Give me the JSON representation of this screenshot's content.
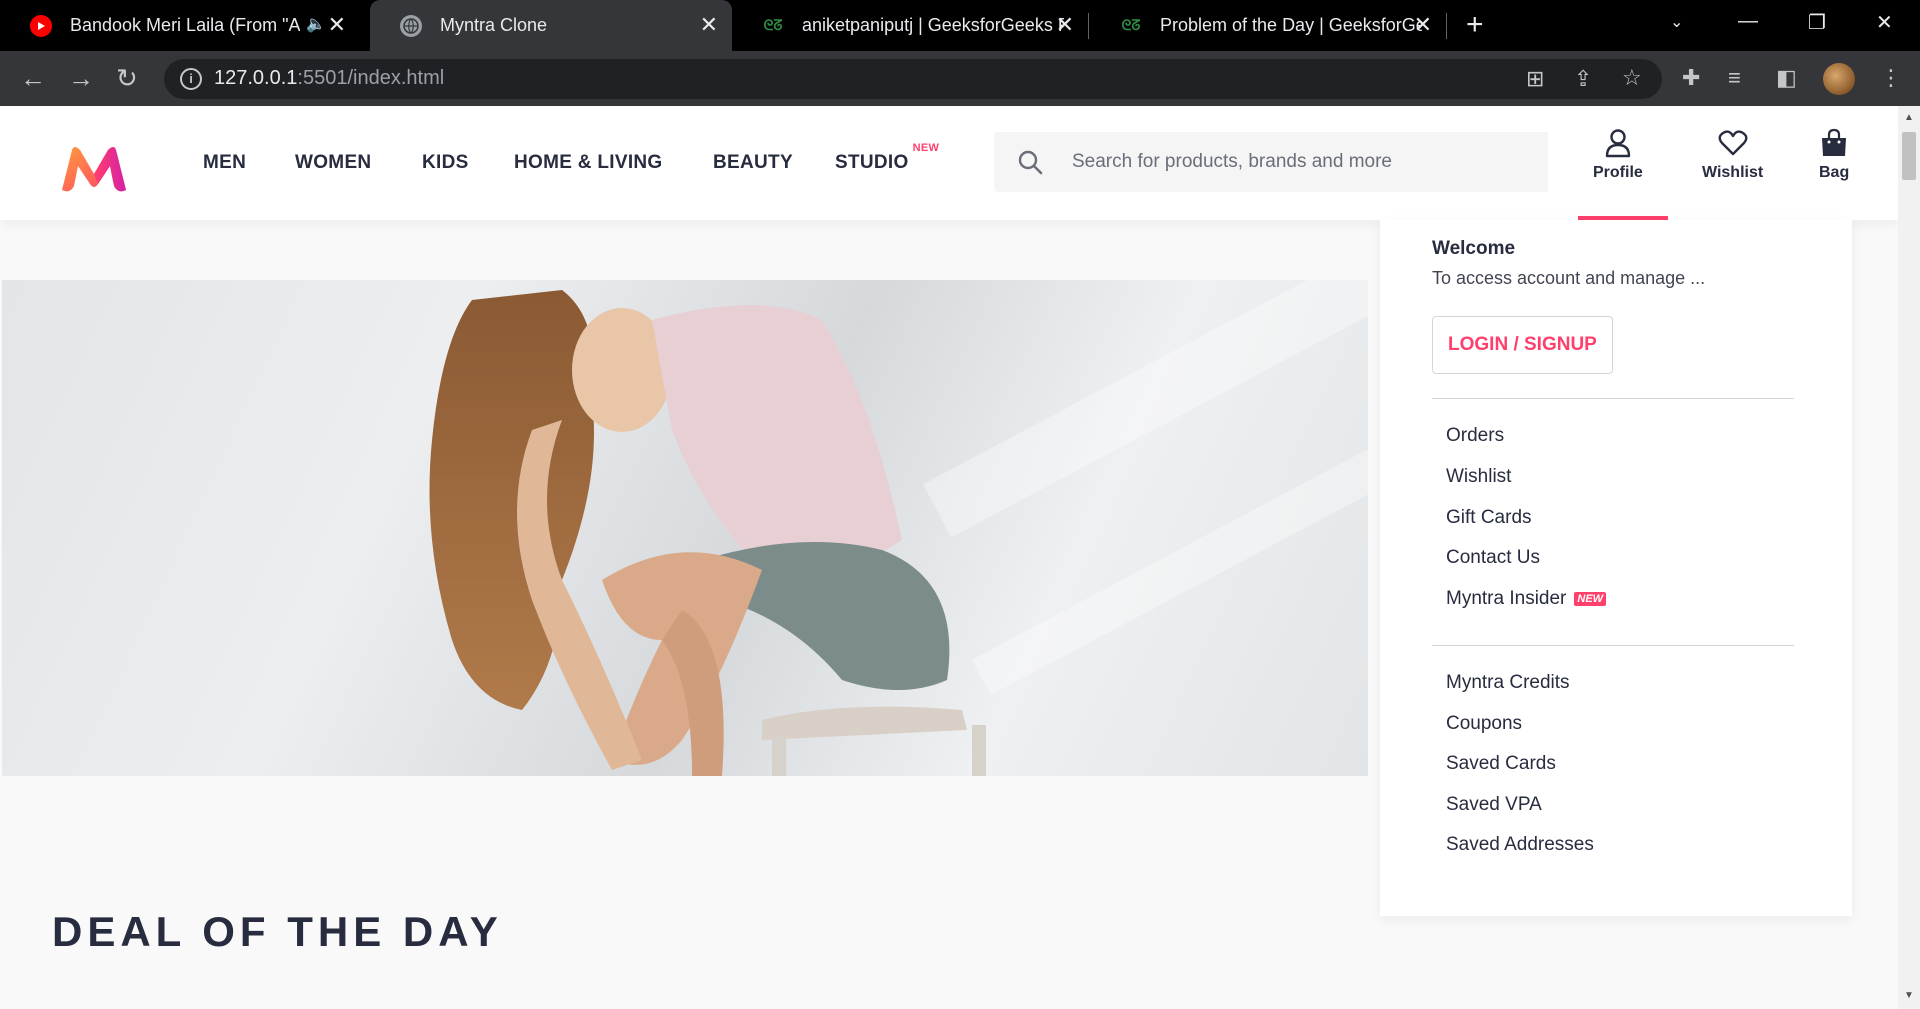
{
  "browser": {
    "tabs": [
      {
        "title": "Bandook Meri Laila (From \"A",
        "icon": "youtube-icon",
        "muted_audio": true
      },
      {
        "title": "Myntra Clone",
        "icon": "globe-icon",
        "active": true
      },
      {
        "title": "aniketpaniputj | GeeksforGeeks P",
        "icon": "gfg-icon"
      },
      {
        "title": "Problem of the Day | GeeksforGe",
        "icon": "gfg-icon"
      }
    ],
    "url_host": "127.0.0.1",
    "url_rest": ":5501/index.html"
  },
  "header": {
    "nav": [
      "MEN",
      "WOMEN",
      "KIDS",
      "HOME & LIVING",
      "BEAUTY",
      "STUDIO"
    ],
    "studio_badge": "NEW",
    "search_placeholder": "Search for products, brands and more",
    "actions": {
      "profile": "Profile",
      "wishlist": "Wishlist",
      "bag": "Bag"
    }
  },
  "dropdown": {
    "welcome": "Welcome",
    "subtitle": "To access account and manage ...",
    "login": "LOGIN / SIGNUP",
    "group1": [
      "Orders",
      "Wishlist",
      "Gift Cards",
      "Contact Us",
      "Myntra Insider"
    ],
    "insider_badge": "NEW",
    "group2": [
      "Myntra Credits",
      "Coupons",
      "Saved Cards",
      "Saved VPA",
      "Saved Addresses"
    ]
  },
  "section_title": "DEAL OF THE DAY",
  "colors": {
    "accent": "#ff3f6c",
    "text": "#282c3f",
    "chrome_bg": "#35363a"
  }
}
